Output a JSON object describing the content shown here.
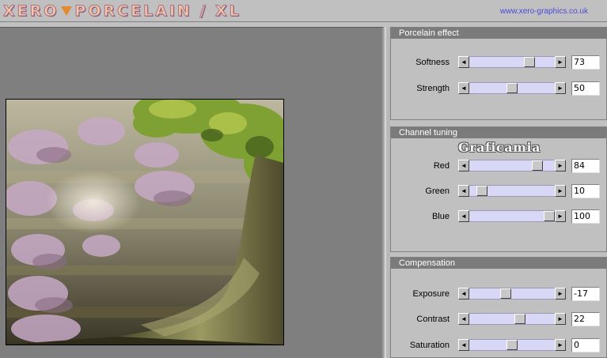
{
  "header": {
    "logo_part1": "XERO",
    "logo_part2": "PORCELAIN / XL",
    "website": "www.xero-graphics.co.uk"
  },
  "preview": {
    "image_description_colors": {
      "sky": "#d8d4c0",
      "foliage": "#8aa83a",
      "flowers": "#c8a8c8",
      "trunk": "#6a6a3a"
    }
  },
  "panels": {
    "porcelain": {
      "title": "Porcelain effect",
      "sliders": [
        {
          "label": "Softness",
          "value": "73",
          "level": 73
        },
        {
          "label": "Strength",
          "value": "50",
          "level": 50
        }
      ]
    },
    "channel": {
      "title": "Channel tuning",
      "watermark": "Graficamia",
      "sliders": [
        {
          "label": "Red",
          "value": "84",
          "level": 84
        },
        {
          "label": "Green",
          "value": "10",
          "level": 10
        },
        {
          "label": "Blue",
          "value": "100",
          "level": 100
        }
      ]
    },
    "compensation": {
      "title": "Compensation",
      "sliders": [
        {
          "label": "Exposure",
          "value": "-17",
          "level": 41.5
        },
        {
          "label": "Contrast",
          "value": "22",
          "level": 61
        },
        {
          "label": "Saturation",
          "value": "0",
          "level": 50
        }
      ]
    }
  },
  "icons": {
    "left_arrow": "◄",
    "right_arrow": "►"
  }
}
